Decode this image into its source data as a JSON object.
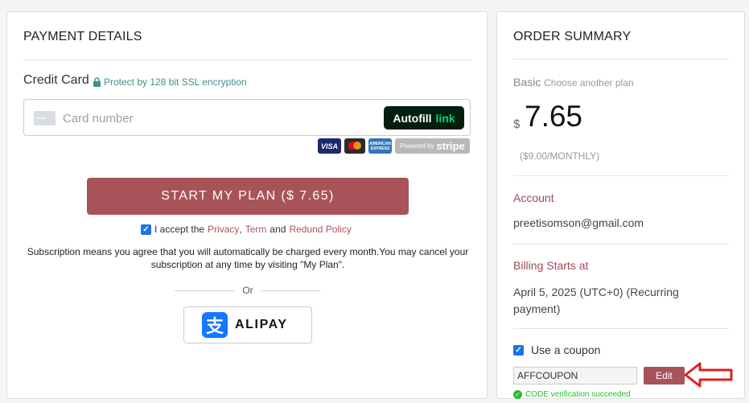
{
  "payment": {
    "title": "PAYMENT DETAILS",
    "credit_card_label": "Credit Card",
    "ssl_text": "Protect by 128 bit SSL encryption",
    "card_placeholder": "Card number",
    "autofill_text": "Autofill",
    "autofill_link": "link",
    "brands": [
      "VISA",
      "Mastercard",
      "AMERICAN EXPRESS"
    ],
    "stripe_prefix": "Powered by",
    "stripe_name": "stripe",
    "start_button": "START MY PLAN ($ 7.65)",
    "accept_prefix": "I accept the",
    "privacy": "Privacy",
    "comma": ",",
    "term": "Term",
    "and": "and",
    "refund": "Redund Policy",
    "subscription_note": "Subscription means you agree that you will automatically be charged every month.You may cancel your subscription at any time by visiting \"My Plan\".",
    "or": "Or",
    "alipay": "ALIPAY"
  },
  "summary": {
    "title": "ORDER SUMMARY",
    "plan": "Basic",
    "choose_plan": "Choose another plan",
    "currency": "$",
    "price": "7.65",
    "per_month": "($9.00/MONTHLY)",
    "account_label": "Account",
    "account_email": "preetisomson@gmail.com",
    "billing_label": "Billing Starts at",
    "billing_date": "April 5, 2025 (UTC+0) (Recurring payment)",
    "use_coupon": "Use a coupon",
    "coupon_code": "AFFCOUPON",
    "edit_button": "Edit",
    "verification": "CODE verification succeeded"
  },
  "colors": {
    "accent": "#a8535a",
    "link_green": "#00d66f",
    "success": "#2eb82e",
    "arrow": "#e02020"
  }
}
